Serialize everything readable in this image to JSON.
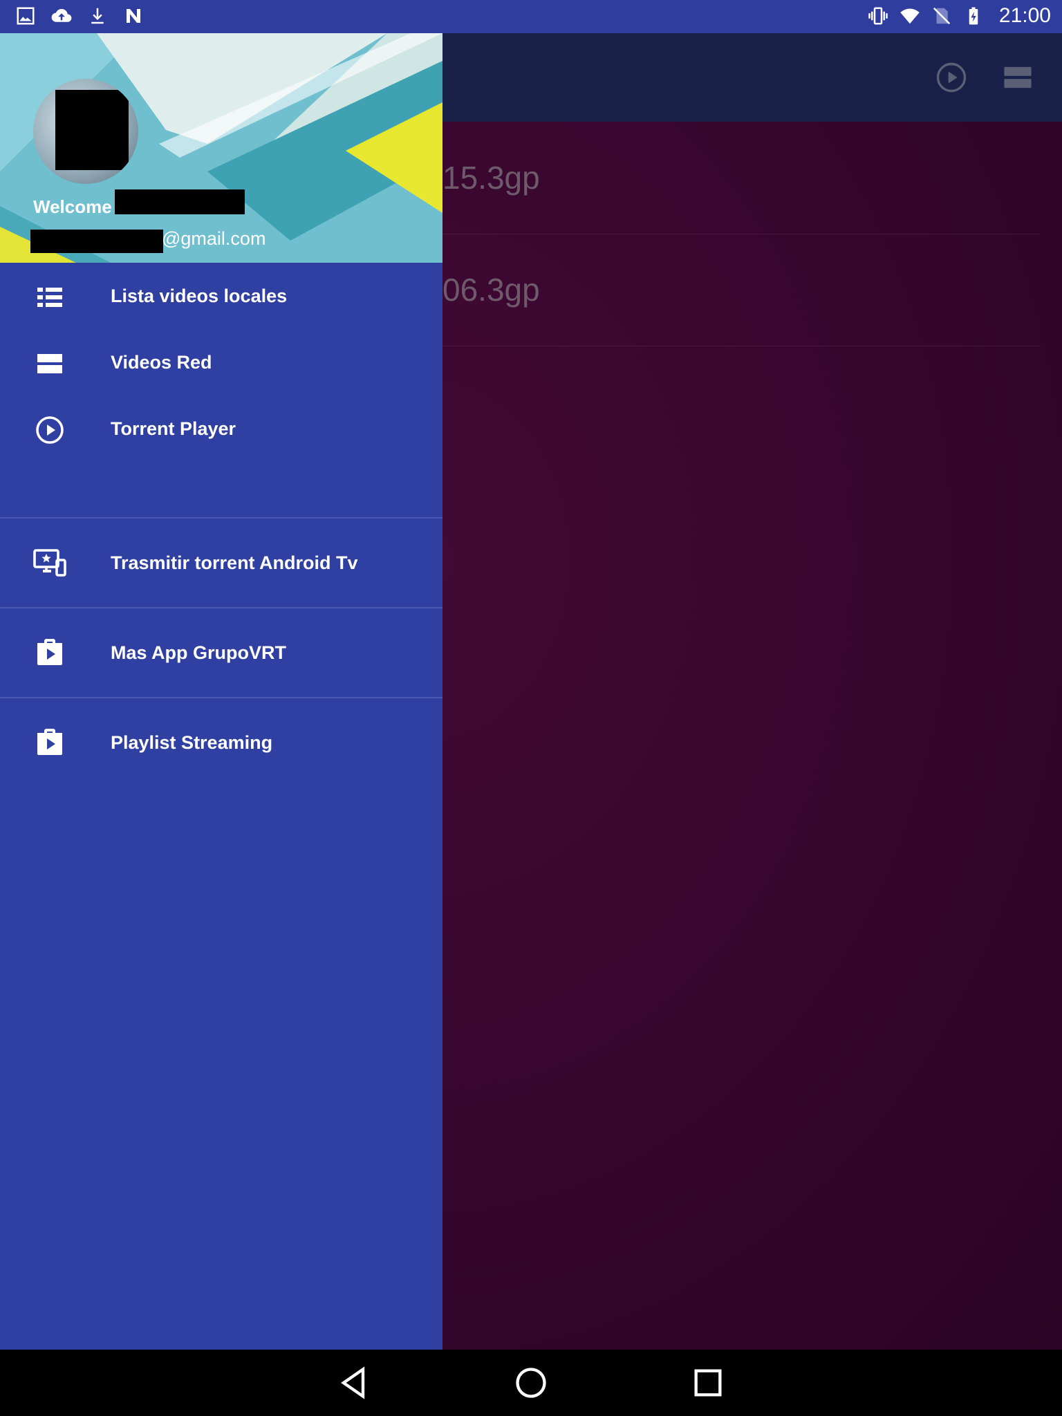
{
  "status_bar": {
    "time": "21:00",
    "left_icons": [
      "image-icon",
      "cloud-upload-icon",
      "download-icon",
      "n-app-icon"
    ],
    "right_icons": [
      "vibrate-icon",
      "wifi-icon",
      "no-sim-icon",
      "battery-charging-icon"
    ]
  },
  "main": {
    "appbar_icons": [
      "play-circle-icon",
      "view-stream-icon"
    ],
    "files": [
      {
        "name_fragment": "15.3gp"
      },
      {
        "name_fragment": "06.3gp"
      }
    ]
  },
  "drawer": {
    "header": {
      "welcome": "Welcome",
      "email_suffix": "@gmail.com"
    },
    "items": [
      {
        "label": "Lista videos locales",
        "icon": "list-icon"
      },
      {
        "label": "Videos Red",
        "icon": "view-stream-icon"
      },
      {
        "label": "Torrent Player",
        "icon": "play-circle-icon"
      },
      {
        "label": "Trasmitir torrent Android Tv",
        "icon": "cast-devices-icon"
      },
      {
        "label": "Mas App GrupoVRT",
        "icon": "shop-icon"
      },
      {
        "label": "Playlist Streaming",
        "icon": "shop-icon"
      }
    ]
  },
  "colors": {
    "drawer_bg": "#3040a2",
    "status_bar": "#2f3d9f",
    "appbar": "#1a2148",
    "main_bg": "#3a0832"
  }
}
